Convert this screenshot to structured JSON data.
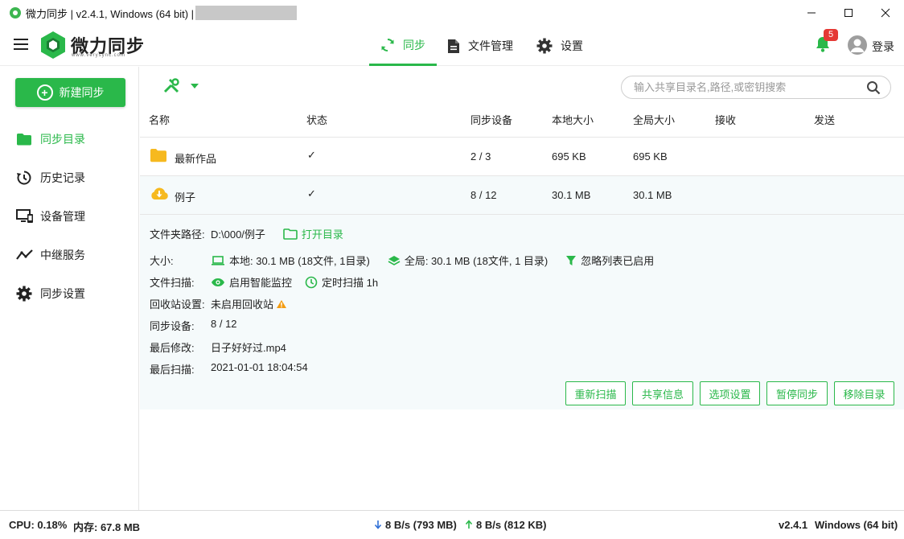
{
  "window": {
    "title": "微力同步 | v2.4.1, Windows (64 bit) |"
  },
  "header": {
    "brand": "微力同步",
    "brand_sub": "www.verysync.com",
    "tabs": [
      {
        "label": "同步",
        "icon": "sync-icon",
        "active": true
      },
      {
        "label": "文件管理",
        "icon": "file-icon",
        "active": false
      },
      {
        "label": "设置",
        "icon": "gear-icon",
        "active": false
      }
    ],
    "notification_count": "5",
    "login_label": "登录"
  },
  "sidebar": {
    "new_sync_label": "新建同步",
    "items": [
      {
        "label": "同步目录",
        "icon": "folder-icon",
        "active": true
      },
      {
        "label": "历史记录",
        "icon": "history-icon",
        "active": false
      },
      {
        "label": "设备管理",
        "icon": "devices-icon",
        "active": false
      },
      {
        "label": "中继服务",
        "icon": "relay-icon",
        "active": false
      },
      {
        "label": "同步设置",
        "icon": "gear-icon",
        "active": false
      }
    ]
  },
  "search": {
    "placeholder": "输入共享目录名,路径,或密钥搜索"
  },
  "table": {
    "columns": [
      "名称",
      "状态",
      "同步设备",
      "本地大小",
      "全局大小",
      "接收",
      "发送"
    ],
    "rows": [
      {
        "name": "最新作品",
        "status": "✓",
        "devices": "2 / 3",
        "local_size": "695 KB",
        "global_size": "695 KB",
        "receive": "",
        "send": ""
      },
      {
        "name": "例子",
        "status": "✓",
        "devices": "8 / 12",
        "local_size": "30.1 MB",
        "global_size": "30.1 MB",
        "receive": "",
        "send": ""
      }
    ]
  },
  "detail": {
    "path_label": "文件夹路径:",
    "path_value": "D:\\000/例子",
    "open_dir": "打开目录",
    "size_label": "大小:",
    "local_size": "本地: 30.1 MB (18文件, 1目录)",
    "global_size": "全局: 30.1 MB (18文件, 1 目录)",
    "ignore_list": "忽略列表已启用",
    "scan_label": "文件扫描:",
    "smart_monitor": "启用智能监控",
    "timed_scan": "定时扫描 1h",
    "recycle_label": "回收站设置:",
    "recycle_value": "未启用回收站",
    "devices_label": "同步设备:",
    "devices_value": "8 / 12",
    "modified_label": "最后修改:",
    "modified_value": "日子好好过.mp4",
    "scanned_label": "最后扫描:",
    "scanned_value": "2021-01-01 18:04:54",
    "buttons": [
      "重新扫描",
      "共享信息",
      "选项设置",
      "暂停同步",
      "移除目录"
    ]
  },
  "statusbar": {
    "cpu": "CPU: 0.18%",
    "memory": "内存: 67.8 MB",
    "download": "8 B/s (793 MB)",
    "upload": "8 B/s (812 KB)",
    "version": "v2.4.1",
    "os": "Windows (64 bit)"
  },
  "colors": {
    "accent": "#2ab84a",
    "folder": "#f6b91f",
    "badge": "#e53935",
    "warning": "#f39c12"
  }
}
